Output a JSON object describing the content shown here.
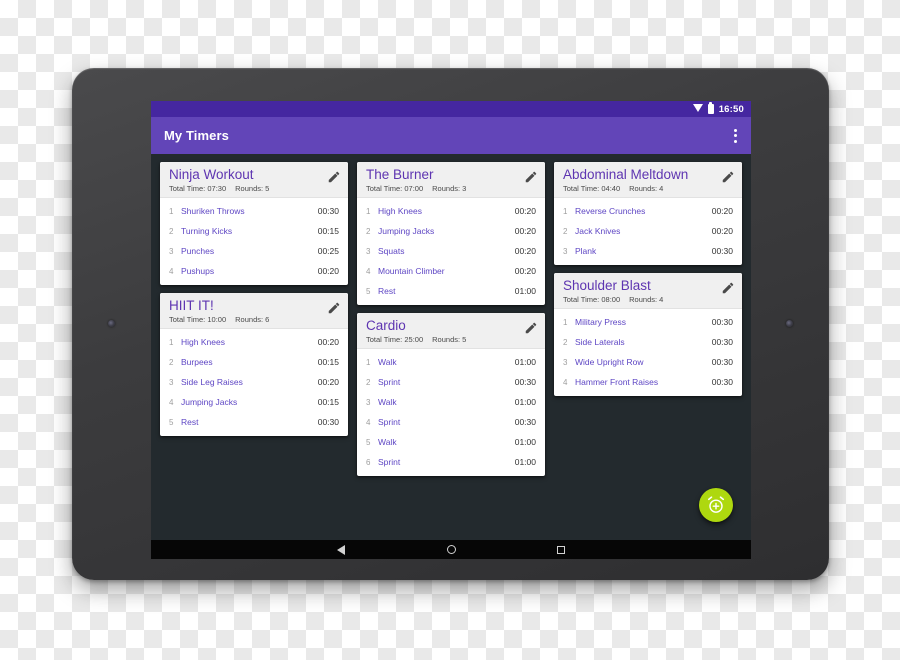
{
  "status_bar": {
    "clock": "16:50",
    "wifi_icon": "wifi-icon",
    "battery_icon": "battery-icon"
  },
  "toolbar": {
    "title": "My Timers",
    "overflow_icon": "overflow-menu-icon"
  },
  "colors": {
    "status_bar": "#4527a0",
    "toolbar": "#6245b8",
    "app_background": "#232a2e",
    "card_background": "#ffffff",
    "card_header": "#f0f0f0",
    "title_accent": "#5e35b1",
    "exercise_accent": "#5e46c4",
    "fab": "#aed80f"
  },
  "fab": {
    "icon": "alarm-add-icon"
  },
  "nav_bar": {
    "back": "back-icon",
    "home": "home-icon",
    "recents": "recents-icon"
  },
  "labels": {
    "total_time_prefix": "Total Time:",
    "rounds_prefix": "Rounds:",
    "edit_icon": "edit-pencil-icon"
  },
  "columns": [
    {
      "cards": [
        {
          "title": "Ninja Workout",
          "total_time": "07:30",
          "rounds": "5",
          "exercises": [
            {
              "index": "1",
              "name": "Shuriken Throws",
              "time": "00:30"
            },
            {
              "index": "2",
              "name": "Turning Kicks",
              "time": "00:15"
            },
            {
              "index": "3",
              "name": "Punches",
              "time": "00:25"
            },
            {
              "index": "4",
              "name": "Pushups",
              "time": "00:20"
            }
          ]
        },
        {
          "title": "HIIT IT!",
          "total_time": "10:00",
          "rounds": "6",
          "exercises": [
            {
              "index": "1",
              "name": "High Knees",
              "time": "00:20"
            },
            {
              "index": "2",
              "name": "Burpees",
              "time": "00:15"
            },
            {
              "index": "3",
              "name": "Side Leg Raises",
              "time": "00:20"
            },
            {
              "index": "4",
              "name": "Jumping Jacks",
              "time": "00:15"
            },
            {
              "index": "5",
              "name": "Rest",
              "time": "00:30"
            }
          ]
        }
      ]
    },
    {
      "cards": [
        {
          "title": "The Burner",
          "total_time": "07:00",
          "rounds": "3",
          "exercises": [
            {
              "index": "1",
              "name": "High Knees",
              "time": "00:20"
            },
            {
              "index": "2",
              "name": "Jumping Jacks",
              "time": "00:20"
            },
            {
              "index": "3",
              "name": "Squats",
              "time": "00:20"
            },
            {
              "index": "4",
              "name": "Mountain Climber",
              "time": "00:20"
            },
            {
              "index": "5",
              "name": "Rest",
              "time": "01:00"
            }
          ]
        },
        {
          "title": "Cardio",
          "total_time": "25:00",
          "rounds": "5",
          "exercises": [
            {
              "index": "1",
              "name": "Walk",
              "time": "01:00"
            },
            {
              "index": "2",
              "name": "Sprint",
              "time": "00:30"
            },
            {
              "index": "3",
              "name": "Walk",
              "time": "01:00"
            },
            {
              "index": "4",
              "name": "Sprint",
              "time": "00:30"
            },
            {
              "index": "5",
              "name": "Walk",
              "time": "01:00"
            },
            {
              "index": "6",
              "name": "Sprint",
              "time": "01:00"
            }
          ]
        }
      ]
    },
    {
      "cards": [
        {
          "title": "Abdominal Meltdown",
          "total_time": "04:40",
          "rounds": "4",
          "exercises": [
            {
              "index": "1",
              "name": "Reverse Crunches",
              "time": "00:20"
            },
            {
              "index": "2",
              "name": "Jack Knives",
              "time": "00:20"
            },
            {
              "index": "3",
              "name": "Plank",
              "time": "00:30"
            }
          ]
        },
        {
          "title": "Shoulder Blast",
          "total_time": "08:00",
          "rounds": "4",
          "exercises": [
            {
              "index": "1",
              "name": "Military Press",
              "time": "00:30"
            },
            {
              "index": "2",
              "name": "Side Laterals",
              "time": "00:30"
            },
            {
              "index": "3",
              "name": "Wide Upright Row",
              "time": "00:30"
            },
            {
              "index": "4",
              "name": "Hammer Front Raises",
              "time": "00:30"
            }
          ]
        }
      ]
    }
  ]
}
